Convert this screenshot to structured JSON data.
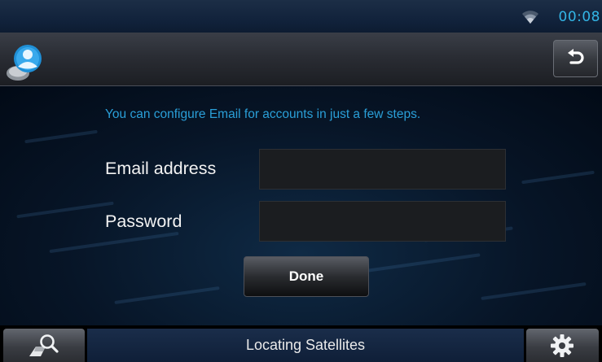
{
  "status_bar": {
    "time": "00:08",
    "wifi_icon": "wifi-icon"
  },
  "title_bar": {
    "app_icon": "email-account-icon",
    "back_icon": "back-arrow-icon"
  },
  "form": {
    "intro": "You can configure Email for accounts in just a few steps.",
    "email_label": "Email address",
    "email_value": "",
    "password_label": "Password",
    "password_value": "",
    "done_label": "Done"
  },
  "bottom_bar": {
    "nav_icon": "map-search-icon",
    "status_text": "Locating Satellites",
    "settings_icon": "gear-icon"
  },
  "colors": {
    "accent": "#33b5e5",
    "intro_text": "#2a9fd8",
    "status_strip": "#142644"
  }
}
